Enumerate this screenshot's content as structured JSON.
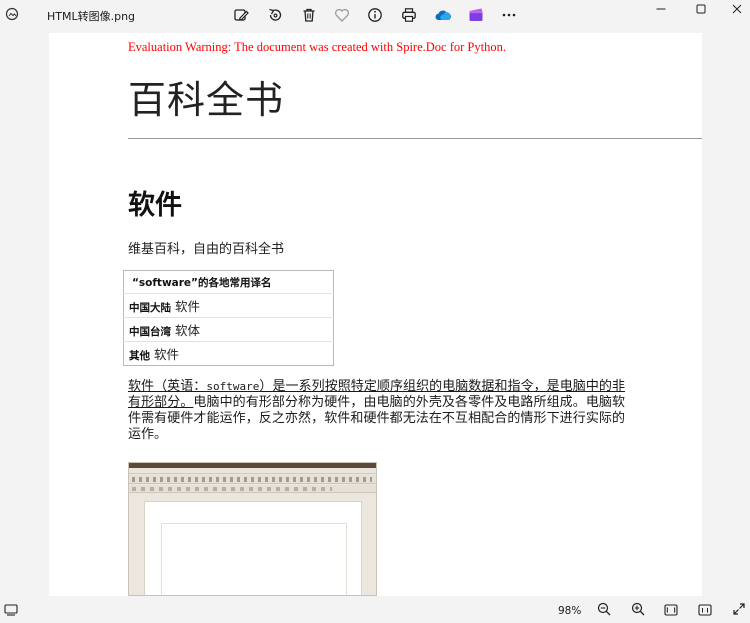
{
  "window": {
    "file_name": "HTML转图像.png"
  },
  "toolbar": {
    "icons": [
      "edit-image-icon",
      "rotate-icon",
      "delete-icon",
      "favorite-icon",
      "info-icon",
      "print-icon",
      "onedrive-icon",
      "clipchamp-icon",
      "more-icon"
    ],
    "accent": "#0f6cbd",
    "onedrive_color": "#0f6cbd",
    "clipchamp_color": "#7b3fe4"
  },
  "document": {
    "warning": "Evaluation Warning: The document was created with Spire.Doc for Python.",
    "warning_color": "#ff0000",
    "title": "百科全书",
    "heading": "软件",
    "subtitle": "维基百科，自由的百科全书",
    "table": {
      "header": "“software”的各地常用译名",
      "rows": [
        {
          "key": "中国大陆",
          "value": "软件"
        },
        {
          "key": "中国台湾",
          "value": "软体"
        },
        {
          "key": "其他",
          "value": "软件"
        }
      ]
    },
    "paragraph": {
      "underlined_1": "软件（英语：",
      "mono_term": "software",
      "underlined_2": "）是一系列按照特定顺序组织的电脑数据和指令，是电脑中的非有形部分。",
      "plain": "电脑中的有形部分称为硬件，由电脑的外壳及各零件及电路所组成。电脑软件需有硬件才能运作，反之亦然，软件和硬件都无法在不互相配合的情形下进行实际的运作。"
    }
  },
  "statusbar": {
    "zoom": "98%"
  }
}
